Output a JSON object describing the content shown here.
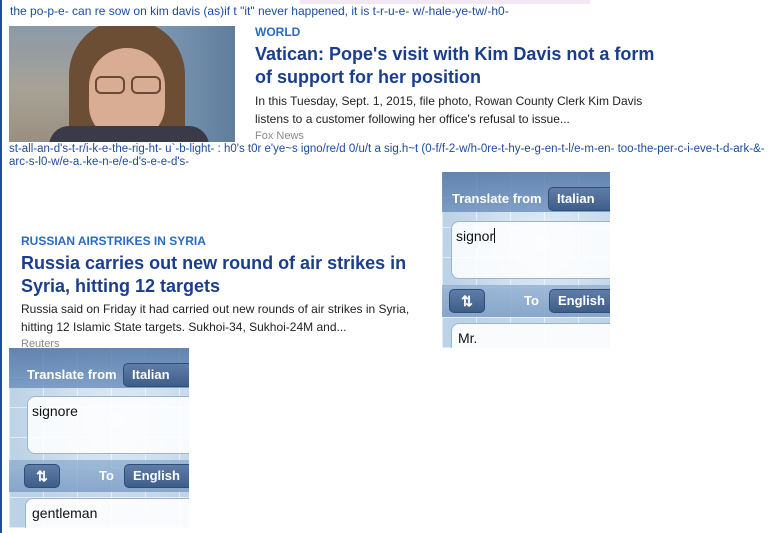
{
  "tagline": "the po-p-e- can re sow on kim davis (as)if t \"it\" never happened, it is t-r-u-e- w/-hale-ye-tw/-h0-",
  "article1": {
    "kicker": "WORLD",
    "headline": "Vatican: Pope's visit with Kim Davis not a form of support for her position",
    "summary": "In this Tuesday, Sept. 1, 2015, file photo, Rowan County Clerk Kim Davis listens to a customer following her office's refusal to issue...",
    "source": "Fox News"
  },
  "long_tagline": "st-all-an-d's-t-r/i-k-e-the-rig-ht- u`-b-light- : h0's t0r e'ye~s igno/re/d 0/u/t a sig.h~t (0-f/f-2-w/h-0re-t-hy-e-g-en-t-l/e-m-en- too-the-per-c-i-eve-t-d-ark-&-arc-s-l0-w/e-a.-ke-n-e/e-d's-e-e-d's-",
  "article2": {
    "kicker": "RUSSIAN AIRSTRIKES IN SYRIA",
    "headline": "Russia carries out new round of air strikes in Syria, hitting 12 targets",
    "summary": "Russia said on Friday it had carried out new rounds of air strikes in Syria, hitting 12 Islamic State targets. Sukhoi-34, Sukhoi-24M and...",
    "source": "Reuters"
  },
  "translator_top": {
    "from_label": "Translate from",
    "from_lang": "Italian",
    "input_text": "signor",
    "swap_icon": "swap-arrows-icon",
    "to_label": "To",
    "to_lang": "English",
    "output_text": "Mr."
  },
  "translator_bottom": {
    "from_label": "Translate from",
    "from_lang": "Italian",
    "input_text": "signore",
    "swap_icon": "swap-arrows-icon",
    "to_label": "To",
    "to_lang": "English",
    "output_text": "gentleman"
  }
}
